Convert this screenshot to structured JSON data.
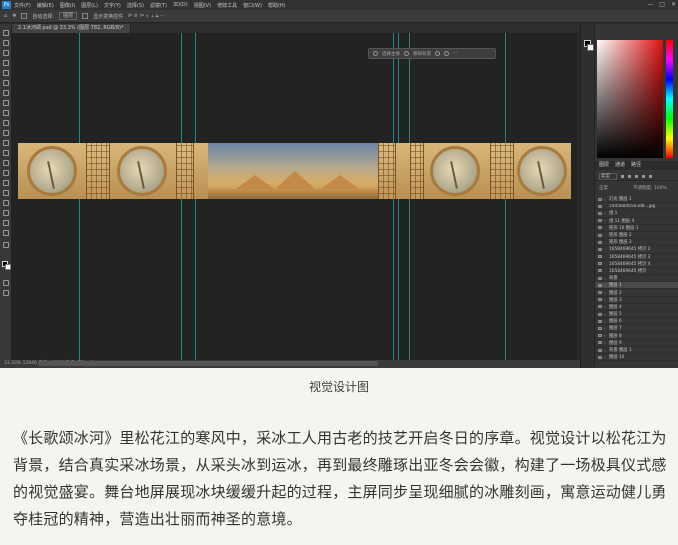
{
  "photoshop": {
    "menu": [
      "文件(F)",
      "编辑(E)",
      "图像(I)",
      "图层(L)",
      "文字(Y)",
      "选择(S)",
      "滤镜(T)",
      "3D(D)",
      "视图(V)",
      "增效工具",
      "窗口(W)",
      "帮助(H)"
    ],
    "window_controls": [
      "—",
      "□",
      "✕"
    ],
    "options": [
      "自动选择:",
      "图层",
      "显示变换控件"
    ],
    "doc_tab": "2.1冰河颂.psd @ 33.3% (图层 782, RGB/8)*",
    "context_bar": [
      "选择主体",
      "移除背景"
    ],
    "status": "33.33%  12040 像素 x 1080 像素 (72 ppi)",
    "panel_tabs": [
      "图层",
      "通道",
      "路径"
    ],
    "filter_kind": "类型",
    "blend": "正常",
    "opacity": "不透明度: 100%",
    "layers": [
      "灯光 图层 1",
      "54456846563d8...jpg",
      "组 1",
      "组 11 图层 4",
      "矩形 16 图层 1",
      "矩形 图层 2",
      "矩形 图层 3",
      "1658469645 拷贝 2",
      "1658469645 拷贝 3",
      "1658469645 拷贝 4",
      "1658469645 拷贝",
      "背景",
      "图层 1",
      "图层 2",
      "图层 3",
      "图层 4",
      "图层 5",
      "图层 6",
      "图层 7",
      "图层 8",
      "图层 9",
      "背景 图层 1",
      "图层 10"
    ]
  },
  "article": {
    "caption": "视觉设计图",
    "paragraph": "《长歌颂冰河》里松花江的寒风中，采冰工人用古老的技艺开启冬日的序章。视觉设计以松花江为背景，结合真实采冰场景，从采头冰到运冰，再到最终雕琢出亚冬会会徽，构建了一场极具仪式感的视觉盛宴。舞台地屏展现冰块缓缓升起的过程，主屏同步呈现细腻的冰雕刻画，寓意运动健儿勇夺桂冠的精神，营造出壮丽而神圣的意境。"
  }
}
